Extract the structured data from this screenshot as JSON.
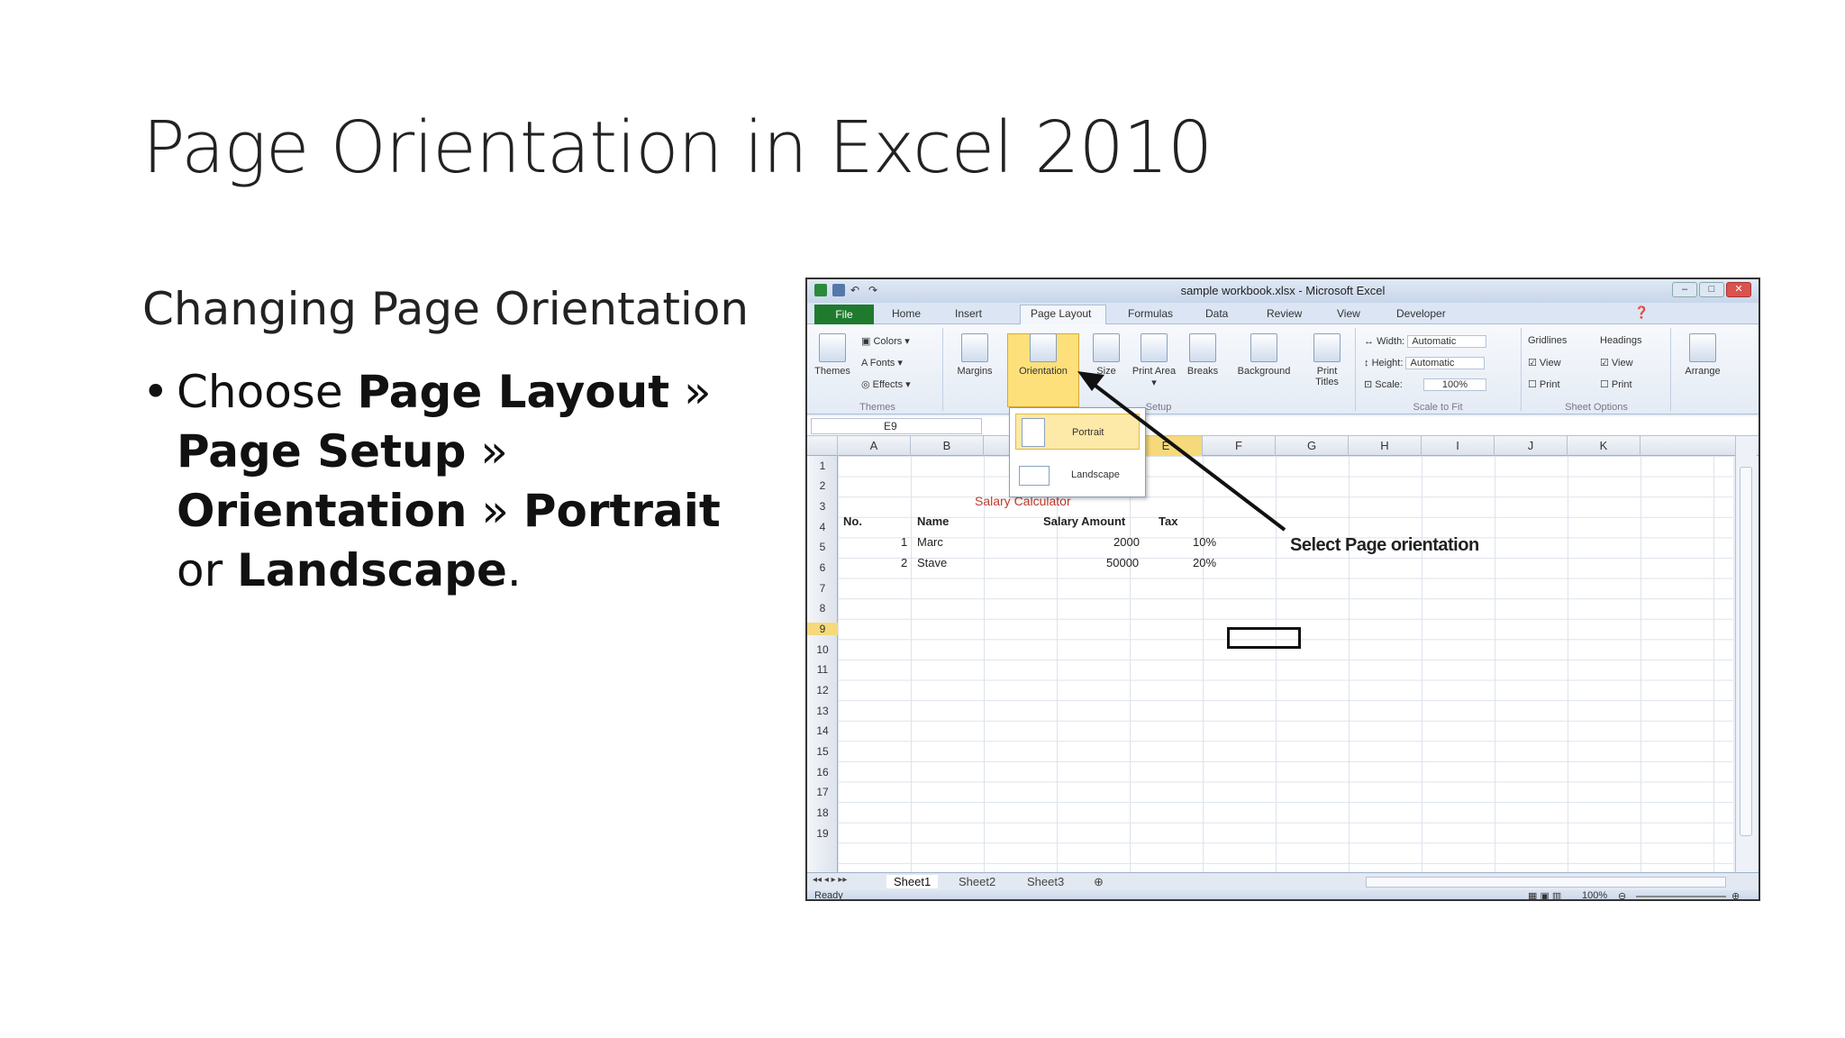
{
  "slide": {
    "title": "Page Orientation in Excel 2010",
    "subtitle": "Changing Page Orientation",
    "bullet": {
      "choose": "Choose ",
      "page_layout": "Page Layout",
      "sep1": " » ",
      "page_setup": "Page Setup",
      "sep2": " » ",
      "orientation": "Orientation",
      "sep3": " » ",
      "portrait": "Portrait",
      "or": " or ",
      "landscape": "Landscape",
      "end": "."
    }
  },
  "excel": {
    "window_title": "sample workbook.xlsx - Microsoft Excel",
    "tabs": [
      "File",
      "Home",
      "Insert",
      "Page Layout",
      "Formulas",
      "Data",
      "Review",
      "View",
      "Developer"
    ],
    "ribbon": {
      "themes": "Themes",
      "colors": "Colors ▾",
      "fonts": "Fonts ▾",
      "effects": "Effects ▾",
      "margins": "Margins",
      "orientation": "Orientation",
      "size": "Size",
      "print_area": "Print Area ▾",
      "breaks": "Breaks",
      "background": "Background",
      "print_titles": "Print Titles",
      "width_label": "Width:",
      "width_value": "Automatic",
      "height_label": "Height:",
      "height_value": "Automatic",
      "scale_label": "Scale:",
      "scale_value": "100%",
      "gridlines": "Gridlines",
      "headings": "Headings",
      "view1": "View",
      "print1": "Print",
      "view2": "View",
      "print2": "Print",
      "arrange": "Arrange",
      "group_themes": "Themes",
      "group_setup": "Setup",
      "group_scale": "Scale to Fit",
      "group_sheet": "Sheet Options"
    },
    "dropdown": {
      "portrait": "Portrait",
      "landscape": "Landscape"
    },
    "name_box": "E9",
    "columns": [
      "A",
      "B",
      "C",
      "D",
      "E",
      "F",
      "G",
      "H",
      "I",
      "J",
      "K"
    ],
    "rows": [
      "1",
      "2",
      "3",
      "4",
      "5",
      "6",
      "7",
      "8",
      "9",
      "10",
      "11",
      "12",
      "13",
      "14",
      "15",
      "16",
      "17",
      "18",
      "19"
    ],
    "cells": {
      "title": "Salary Calculator",
      "h_no": "No.",
      "h_name": "Name",
      "h_salary": "Salary Amount",
      "h_tax": "Tax",
      "r1_no": "1",
      "r1_name": "Marc",
      "r1_salary": "2000",
      "r1_tax": "10%",
      "r2_no": "2",
      "r2_name": "Stave",
      "r2_salary": "50000",
      "r2_tax": "20%"
    },
    "annotation": "Select Page orientation",
    "sheets": [
      "Sheet1",
      "Sheet2",
      "Sheet3"
    ],
    "status": "Ready",
    "zoom": "100%",
    "colors": {
      "file_tab": "#1f7a2e",
      "highlight": "#fde07a"
    }
  }
}
